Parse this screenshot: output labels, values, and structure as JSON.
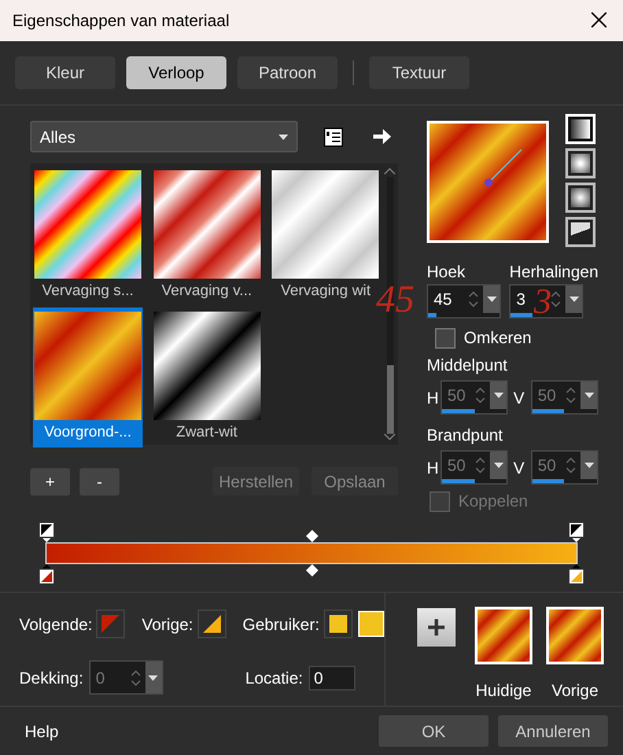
{
  "window": {
    "title": "Eigenschappen van materiaal"
  },
  "tabs": [
    {
      "label": "Kleur",
      "selected": false
    },
    {
      "label": "Verloop",
      "selected": true
    },
    {
      "label": "Patroon",
      "selected": false
    },
    {
      "label": "Textuur",
      "selected": false
    }
  ],
  "category": {
    "value": "Alles"
  },
  "gradients": [
    {
      "label": "Vervaging s...",
      "kind": "rainbow",
      "selected": false
    },
    {
      "label": "Vervaging v...",
      "kind": "red",
      "selected": false
    },
    {
      "label": "Vervaging wit",
      "kind": "white",
      "selected": false
    },
    {
      "label": "Voorgrond-...",
      "kind": "fgbg",
      "selected": true
    },
    {
      "label": "Zwart-wit",
      "kind": "bw",
      "selected": false
    }
  ],
  "list_buttons": [
    "+",
    "-"
  ],
  "preset_buttons": [
    {
      "label": "Herstellen",
      "disabled": true
    },
    {
      "label": "Opslaan",
      "disabled": true
    }
  ],
  "styles": [
    {
      "kind": "linear",
      "selected": true
    },
    {
      "kind": "rectangular",
      "selected": false
    },
    {
      "kind": "radial",
      "selected": false
    },
    {
      "kind": "corner",
      "selected": false
    }
  ],
  "angle": {
    "label": "Hoek",
    "value": "45",
    "level": 0.12
  },
  "repeats": {
    "label": "Herhalingen",
    "value": "3",
    "level": 0.3
  },
  "invert": {
    "label": "Omkeren",
    "checked": false
  },
  "center": {
    "label": "Middelpunt",
    "h": {
      "label": "H",
      "value": "50",
      "level": 0.5,
      "disabled": true
    },
    "v": {
      "label": "V",
      "value": "50",
      "level": 0.5,
      "disabled": true
    }
  },
  "focus": {
    "label": "Brandpunt",
    "h": {
      "label": "H",
      "value": "50",
      "level": 0.5,
      "disabled": true
    },
    "v": {
      "label": "V",
      "value": "50",
      "level": 0.5,
      "disabled": true
    }
  },
  "link": {
    "label": "Koppelen",
    "checked": false,
    "disabled": true
  },
  "stops": [
    {
      "color": "#c41e00"
    },
    {
      "color": "#f6b012"
    }
  ],
  "next": {
    "label": "Volgende:"
  },
  "previous": {
    "label": "Vorige:"
  },
  "user": {
    "label": "Gebruiker:",
    "color": "#f2c21f"
  },
  "opacity": {
    "label": "Dekking:",
    "value": "0",
    "disabled": true
  },
  "location": {
    "label": "Locatie:",
    "value": "0"
  },
  "swatches": [
    "Huidige",
    "Vorige"
  ],
  "footer": {
    "help": "Help",
    "ok": "OK",
    "cancel": "Annuleren"
  },
  "annotations": [
    "45",
    "3"
  ]
}
